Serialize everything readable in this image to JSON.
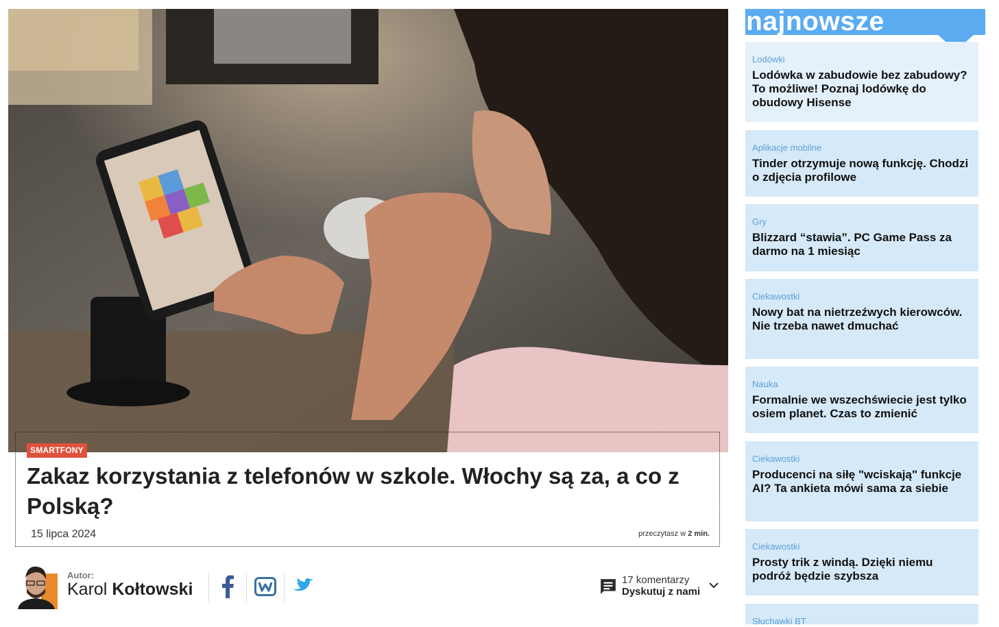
{
  "article": {
    "category": "SMARTFONY",
    "title": "Zakaz korzystania z telefonów w szkole. Włochy są za, a co z Polską?",
    "date": "15 lipca 2024",
    "read_prefix": "przeczytasz w",
    "read_time": "2 min."
  },
  "author": {
    "label": "Autor:",
    "first_name": "Karol",
    "last_name": "Kołtowski"
  },
  "share": {
    "icons": [
      "facebook-icon",
      "wykop-icon",
      "twitter-icon"
    ]
  },
  "comments": {
    "count": "17 komentarzy",
    "cta": "Dyskutuj z nami"
  },
  "sidebar": {
    "title": "najnowsze",
    "accent": "#5aabf0",
    "items": [
      {
        "category": "Lodówki",
        "title": "Lodówka w zabudowie bez zabudowy? To możliwe! Poznaj lodówkę do obudowy Hisense"
      },
      {
        "category": "Aplikacje mobilne",
        "title": "Tinder otrzymuje nową funkcję. Chodzi o zdjęcia profilowe"
      },
      {
        "category": "Gry",
        "title": "Blizzard “stawia”. PC Game Pass za darmo na 1 miesiąc"
      },
      {
        "category": "Ciekawostki",
        "title": "Nowy bat na nietrzeźwych kierowców. Nie trzeba nawet dmuchać"
      },
      {
        "category": "Nauka",
        "title": "Formalnie we wszechświecie jest tylko osiem planet. Czas to zmienić"
      },
      {
        "category": "Ciekawostki",
        "title": "Producenci na siłę \"wciskają\" funkcje AI? Ta ankieta mówi sama za siebie"
      },
      {
        "category": "Ciekawostki",
        "title": "Prosty trik z windą. Dzięki niemu podróż będzie szybsza"
      },
      {
        "category": "Słuchawki BT",
        "title": ""
      }
    ]
  }
}
